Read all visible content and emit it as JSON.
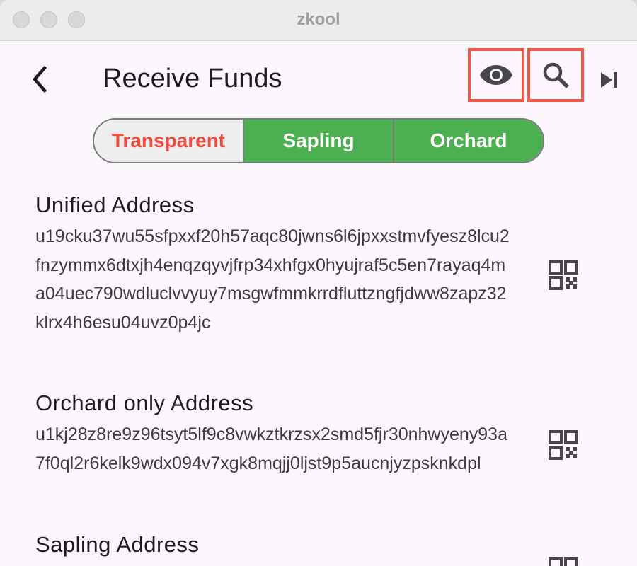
{
  "window": {
    "title": "zkool"
  },
  "header": {
    "title": "Receive Funds"
  },
  "icons": {
    "back": "chevron-left-icon",
    "view": "eye-icon",
    "search": "search-icon",
    "skip": "skip-next-icon",
    "qr": "qr-code-icon"
  },
  "colors": {
    "accent_green": "#4caf50",
    "highlight_red": "#f2594c",
    "transparent_text": "#ef4b3e"
  },
  "pool_selector": {
    "options": [
      "Transparent",
      "Sapling",
      "Orchard"
    ],
    "selected": [
      "Sapling",
      "Orchard"
    ]
  },
  "addresses": [
    {
      "label": "Unified Address",
      "value": "u19cku37wu55sfpxxf20h57aqc80jwns6l6jpxxstmvfyesz8lcu2fnzymmx6dtxjh4enqzqyvjfrp34xhfgx0hyujraf5c5en7rayaq4ma04uec790wdluclvvyuy7msgwfmmkrrdfluttzngfjdww8zapz32klrx4h6esu04uvz0p4jc"
    },
    {
      "label": "Orchard only Address",
      "value": "u1kj28z8re9z96tsyt5lf9c8vwkztkrzsx2smd5fjr30nhwyeny93a7f0ql2r6kelk9wdx094v7xgk8mqjj0ljst9p5aucnjyzpsknkdpl"
    },
    {
      "label": "Sapling Address",
      "value": ""
    }
  ]
}
